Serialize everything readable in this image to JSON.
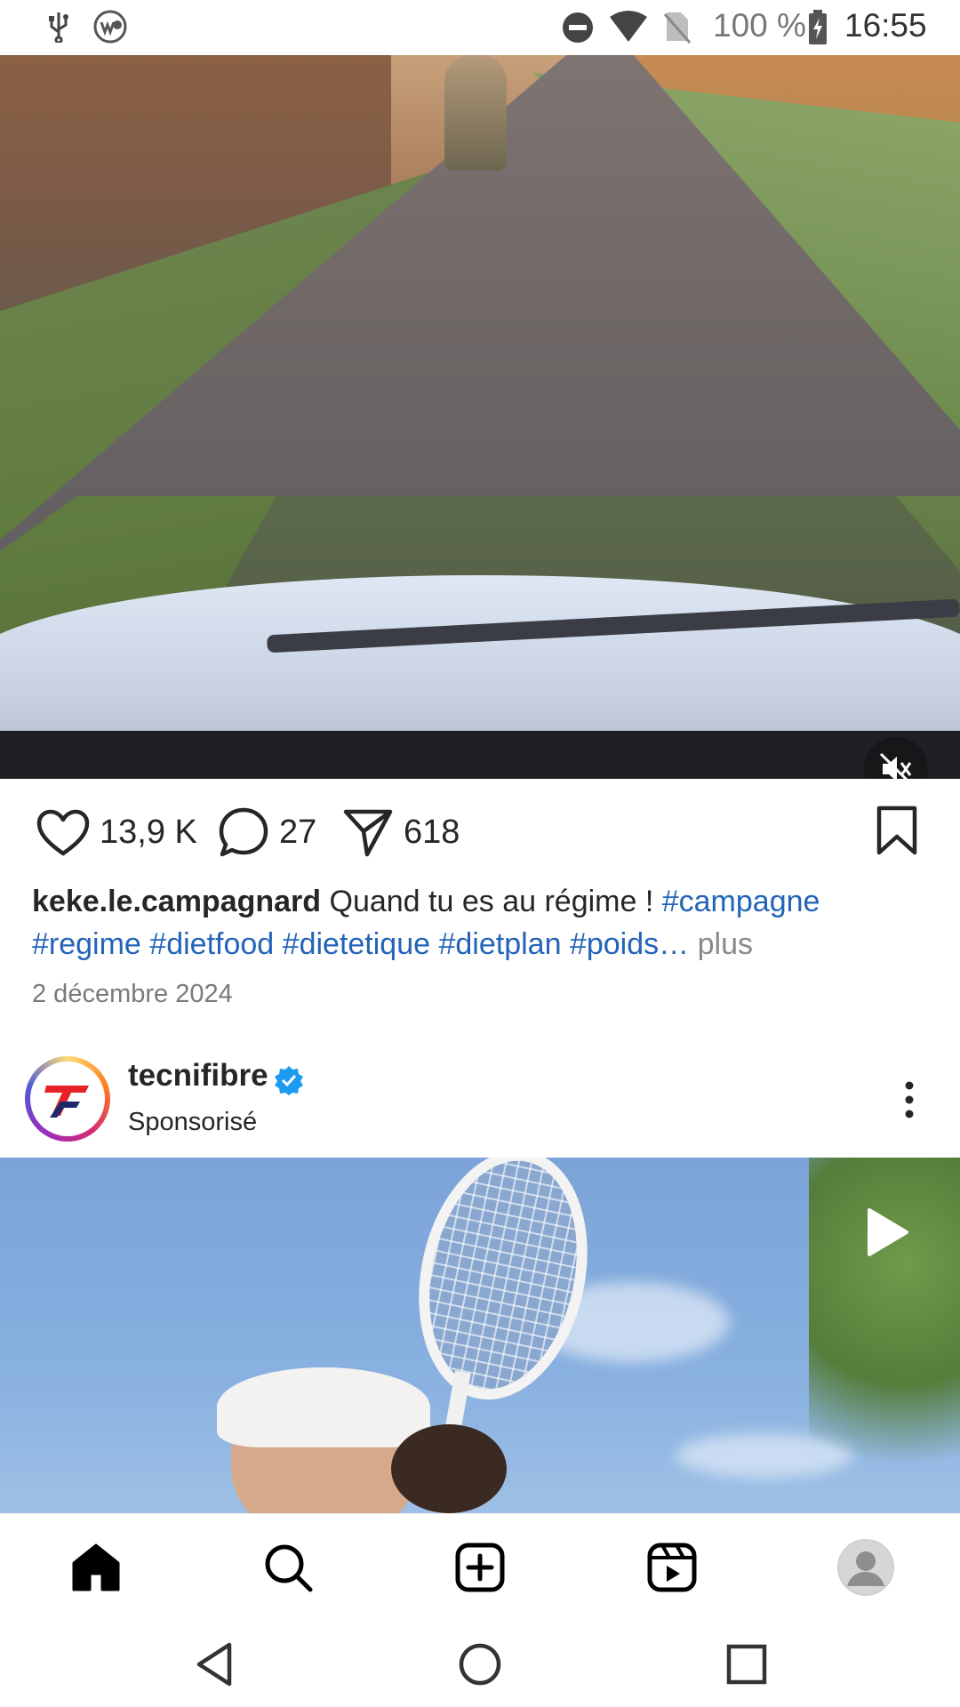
{
  "status_bar": {
    "left_icons": [
      "usb-icon",
      "wd-icon"
    ],
    "right_icons": [
      "dnd-icon",
      "wifi-icon",
      "no-sim-icon",
      "battery-charging-icon"
    ],
    "battery": "100 %",
    "time": "16:55"
  },
  "post1": {
    "media_icons": [
      "volume-off-icon"
    ],
    "likes": "13,9 K",
    "comments": "27",
    "shares": "618",
    "action_icons": [
      "heart-icon",
      "comment-icon",
      "share-icon",
      "bookmark-icon"
    ],
    "username": "keke.le.campagnard",
    "caption_text": " Quand tu es au régime ! ",
    "hashtags": [
      "#campagne",
      "#regime",
      "#dietfood",
      "#dietetique",
      "#dietplan",
      "#poids…"
    ],
    "more_label": " plus",
    "date": "2 décembre 2024"
  },
  "post2": {
    "account_name": "tecnifibre",
    "verified_icon": "verified-badge-icon",
    "sponsored_label": "Sponsorisé",
    "menu_icon": "more-vertical-icon",
    "media_icon": "reel-play-icon"
  },
  "bottom_nav": {
    "items": [
      "home-icon",
      "search-icon",
      "create-icon",
      "reels-icon",
      "profile-avatar"
    ]
  },
  "system_nav": {
    "items": [
      "back-icon",
      "home-circle-icon",
      "recents-icon"
    ]
  },
  "colors": {
    "hashtag": "#2364b8",
    "verified": "#1d9bf0",
    "text": "#262626",
    "muted": "#7a7a7a"
  }
}
